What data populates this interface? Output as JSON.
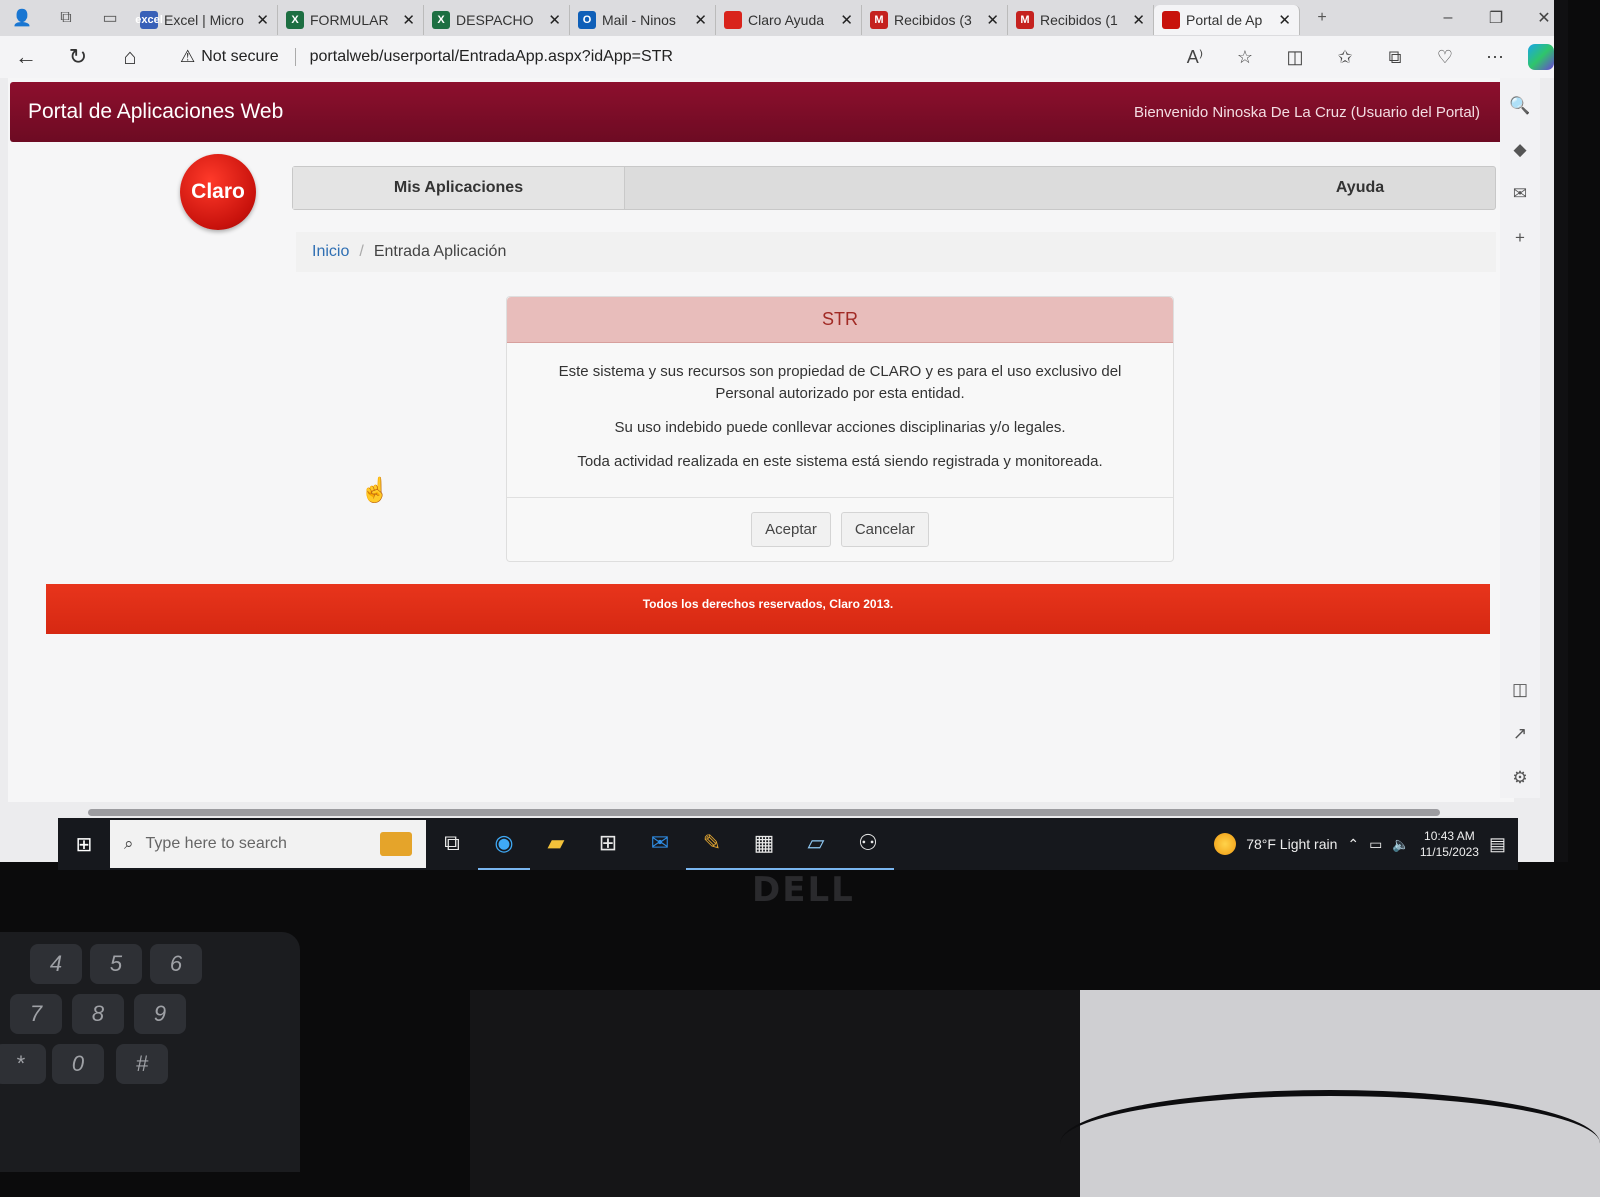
{
  "browser": {
    "tabs": [
      {
        "title": "Excel | Micro",
        "fav": "excel",
        "color": "#3860b8",
        "active": false
      },
      {
        "title": "FORMULAR",
        "fav": "X",
        "color": "#1d6f42",
        "active": false
      },
      {
        "title": "DESPACHO",
        "fav": "X",
        "color": "#1d6f42",
        "active": false
      },
      {
        "title": "Mail - Ninos",
        "fav": "O",
        "color": "#0f5fb8",
        "active": false
      },
      {
        "title": "Claro Ayuda",
        "fav": "",
        "color": "#d9231b",
        "active": false
      },
      {
        "title": "Recibidos (3",
        "fav": "M",
        "color": "#c5221f",
        "active": false
      },
      {
        "title": "Recibidos (1",
        "fav": "M",
        "color": "#c5221f",
        "active": false
      },
      {
        "title": "Portal de Ap",
        "fav": "",
        "color": "#c8120c",
        "active": true
      }
    ],
    "security_text": "Not secure",
    "url": "portalweb/userportal/EntradaApp.aspx?idApp=STR"
  },
  "portal": {
    "title": "Portal de Aplicaciones Web",
    "welcome": "Bienvenido Ninoska De La Cruz (Usuario del Portal)",
    "logo_text": "Claro",
    "nav": {
      "apps": "Mis Aplicaciones",
      "help": "Ayuda"
    },
    "breadcrumb": {
      "home": "Inicio",
      "separator": "/",
      "current": "Entrada Aplicación"
    }
  },
  "dialog": {
    "title": "STR",
    "line1": "Este sistema y sus recursos son propiedad de CLARO y es para el uso exclusivo del Personal autorizado por esta entidad.",
    "line2": "Su uso indebido puede conllevar acciones disciplinarias y/o legales.",
    "line3": "Toda actividad realizada en este sistema está siendo registrada y monitoreada.",
    "accept": "Aceptar",
    "cancel": "Cancelar"
  },
  "footer": {
    "text": "Todos los derechos reservados, Claro 2013."
  },
  "taskbar": {
    "search_placeholder": "Type here to search",
    "weather": "78°F  Light rain",
    "time": "10:43 AM",
    "date": "11/15/2023"
  },
  "monitor": {
    "brand": "DELL"
  },
  "keypad": {
    "keys": [
      "4",
      "5",
      "6",
      "7",
      "8",
      "9",
      "*",
      "0",
      "#"
    ]
  },
  "colors": {
    "header": "#7a0d27",
    "footer": "#e0301a",
    "dialog_head": "#e8bdbb",
    "link": "#2f6fb3"
  }
}
